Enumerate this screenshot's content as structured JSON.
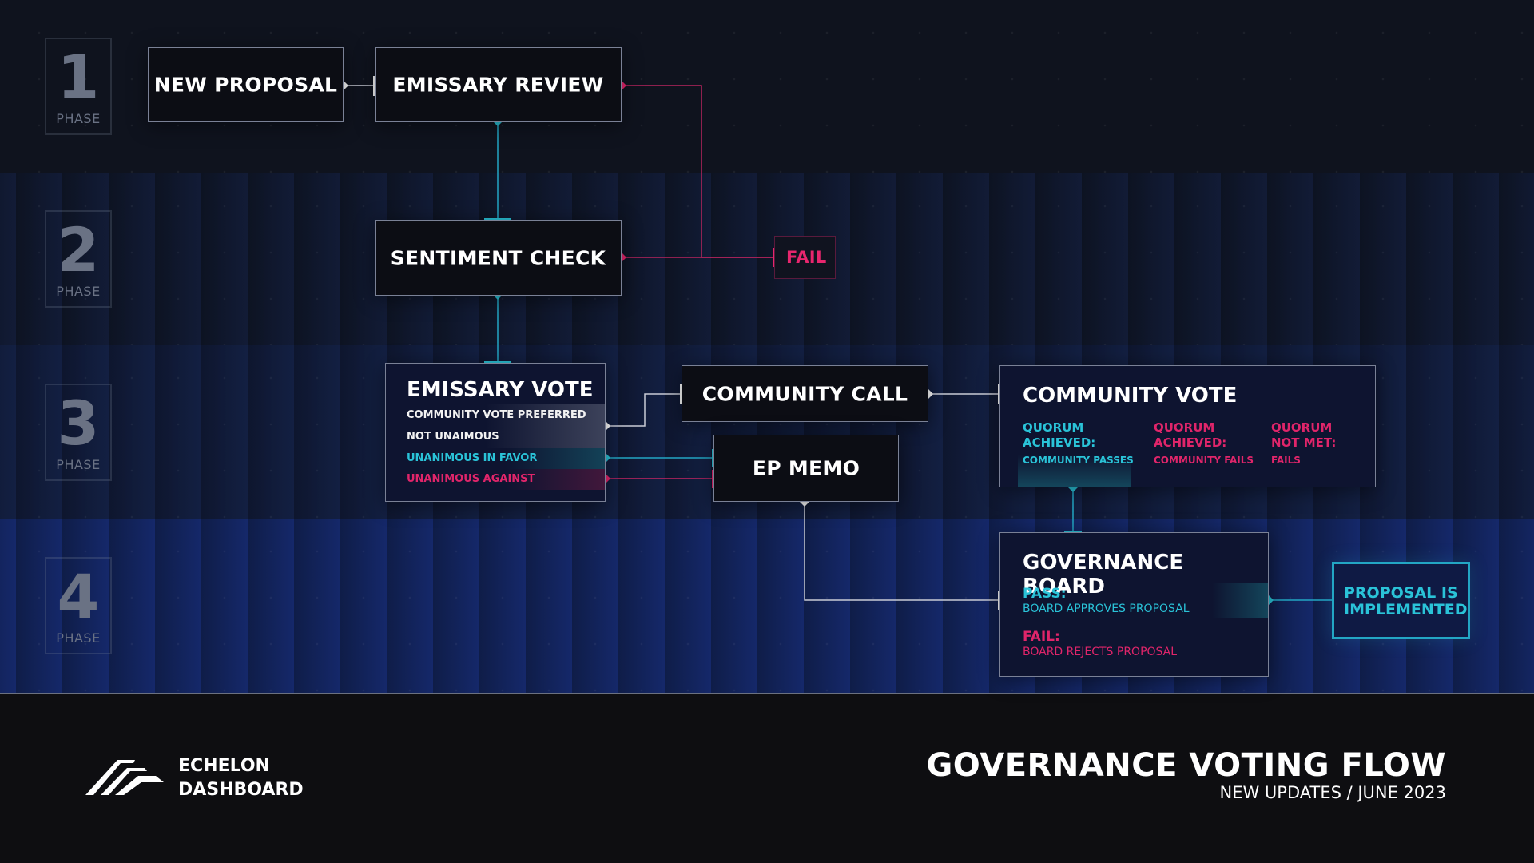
{
  "phases": [
    {
      "number": "1",
      "label": "PHASE"
    },
    {
      "number": "2",
      "label": "PHASE"
    },
    {
      "number": "3",
      "label": "PHASE"
    },
    {
      "number": "4",
      "label": "PHASE"
    }
  ],
  "nodes": {
    "new_proposal": "NEW PROPOSAL",
    "emissary_review": "EMISSARY REVIEW",
    "sentiment_check": "SENTIMENT CHECK",
    "fail": "FAIL",
    "community_call": "COMMUNITY CALL",
    "ep_memo": "EP MEMO",
    "proposal_implemented": "PROPOSAL IS IMPLEMENTED"
  },
  "emissary_vote": {
    "title": "EMISSARY VOTE",
    "options": [
      {
        "label": "COMMUNITY VOTE PREFERRED",
        "tone": "white"
      },
      {
        "label": "NOT UNAIMOUS",
        "tone": "white"
      },
      {
        "label": "UNANIMOUS IN FAVOR",
        "tone": "cyan"
      },
      {
        "label": "UNANIMOUS AGAINST",
        "tone": "pink"
      }
    ]
  },
  "community_vote": {
    "title": "COMMUNITY VOTE",
    "outcomes": [
      {
        "heading": "QUORUM ACHIEVED:",
        "line1": "QUORUM",
        "line2": "ACHIEVED:",
        "result": "COMMUNITY PASSES",
        "tone": "cyan"
      },
      {
        "heading": "QUORUM ACHIEVED:",
        "line1": "QUORUM",
        "line2": "ACHIEVED:",
        "result": "COMMUNITY FAILS",
        "tone": "pink"
      },
      {
        "heading": "QUORUM NOT MET:",
        "line1": "QUORUM",
        "line2": "NOT MET:",
        "result": "FAILS",
        "tone": "pink"
      }
    ]
  },
  "governance_board": {
    "title": "GOVERNANCE BOARD",
    "pass": {
      "heading": "PASS:",
      "detail": "BOARD APPROVES PROPOSAL"
    },
    "fail": {
      "heading": "FAIL:",
      "detail": "BOARD REJECTS PROPOSAL"
    }
  },
  "footer": {
    "brand_line1": "ECHELON",
    "brand_line2": "DASHBOARD",
    "title": "GOVERNANCE VOTING FLOW",
    "subtitle": "NEW UPDATES / JUNE 2023"
  },
  "colors": {
    "accent_cyan": "#2ac3d8",
    "accent_pink": "#e0256a",
    "connector_white": "#e6e8ee"
  }
}
